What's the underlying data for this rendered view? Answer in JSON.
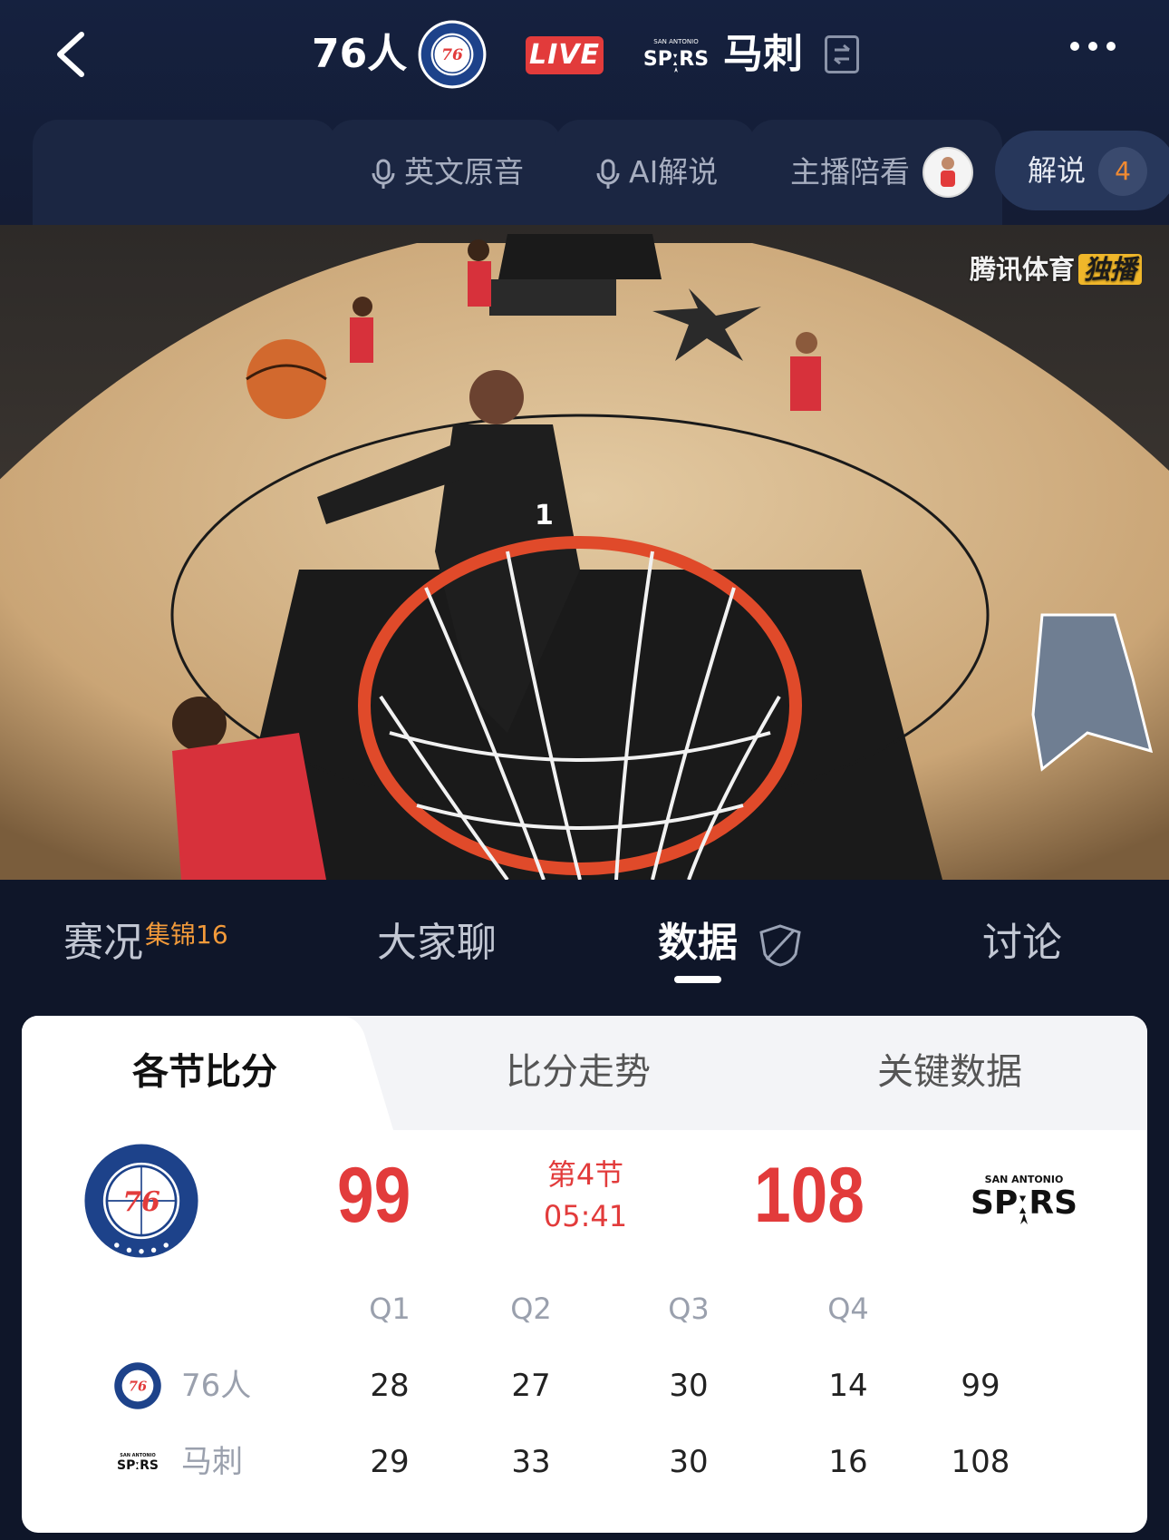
{
  "header": {
    "home_team": "76人",
    "live": "LIVE",
    "away_team": "马刺",
    "icons": [
      "back-arrow-icon",
      "switch-icon",
      "more-icon"
    ]
  },
  "audio_tabs": {
    "items": [
      {
        "label": "英文原音",
        "icon": "microphone-icon"
      },
      {
        "label": "AI解说",
        "icon": "microphone-icon"
      },
      {
        "label": "主播陪看",
        "icon": "avatar"
      }
    ],
    "commentary": {
      "label": "解说",
      "count": "4"
    }
  },
  "video": {
    "watermark": "腾讯体育",
    "watermark_badge": "独播"
  },
  "content_tabs": [
    {
      "label": "赛况",
      "sup": "集锦16",
      "active": false
    },
    {
      "label": "大家聊",
      "active": false
    },
    {
      "label": "数据",
      "active": true
    },
    {
      "label": "讨论",
      "active": false
    }
  ],
  "card": {
    "subtabs": [
      {
        "label": "各节比分",
        "active": true
      },
      {
        "label": "比分走势",
        "active": false
      },
      {
        "label": "关键数据",
        "active": false
      }
    ],
    "home_score": "99",
    "away_score": "108",
    "period": "第4节",
    "clock": "05:41",
    "quarters": [
      "Q1",
      "Q2",
      "Q3",
      "Q4"
    ],
    "rows": [
      {
        "team": "76人",
        "scores": [
          "28",
          "27",
          "30",
          "14"
        ],
        "total": "99"
      },
      {
        "team": "马刺",
        "scores": [
          "29",
          "33",
          "30",
          "16"
        ],
        "total": "108"
      }
    ]
  },
  "colors": {
    "accent_red": "#e23b3b",
    "accent_orange": "#f29a3a",
    "navy": "#0f1629"
  }
}
